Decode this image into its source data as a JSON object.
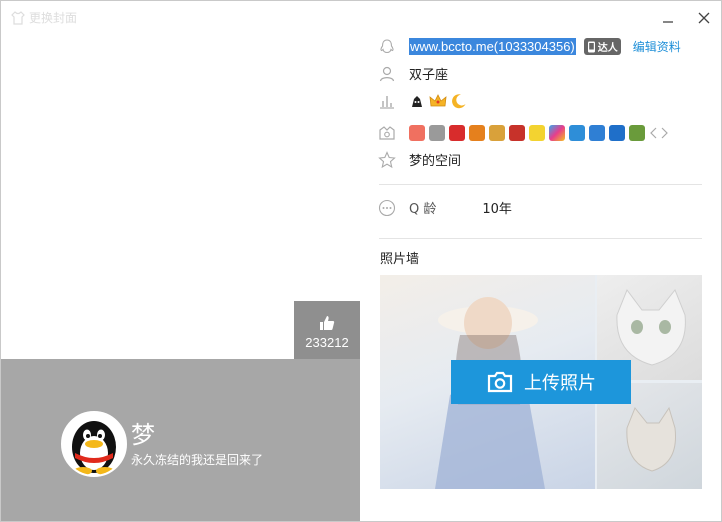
{
  "window": {
    "title": "更换封面"
  },
  "cover": {
    "likes": "233212",
    "nickname": "梦",
    "signature": "永久冻结的我还是回来了"
  },
  "profile": {
    "qq_id": "www.bccto.me(1033304356)",
    "daren_badge": "达人",
    "edit_label": "编辑资料",
    "zodiac": "双子座",
    "space_label": "梦的空间",
    "q_age_label": "Q 龄",
    "q_age_value": "10年"
  },
  "photo_wall": {
    "title": "照片墙",
    "upload_label": "上传照片"
  },
  "colors": {
    "accent": "#1d96db",
    "selection": "#3b87dd",
    "cover_bottom": "#a7a7a7"
  }
}
